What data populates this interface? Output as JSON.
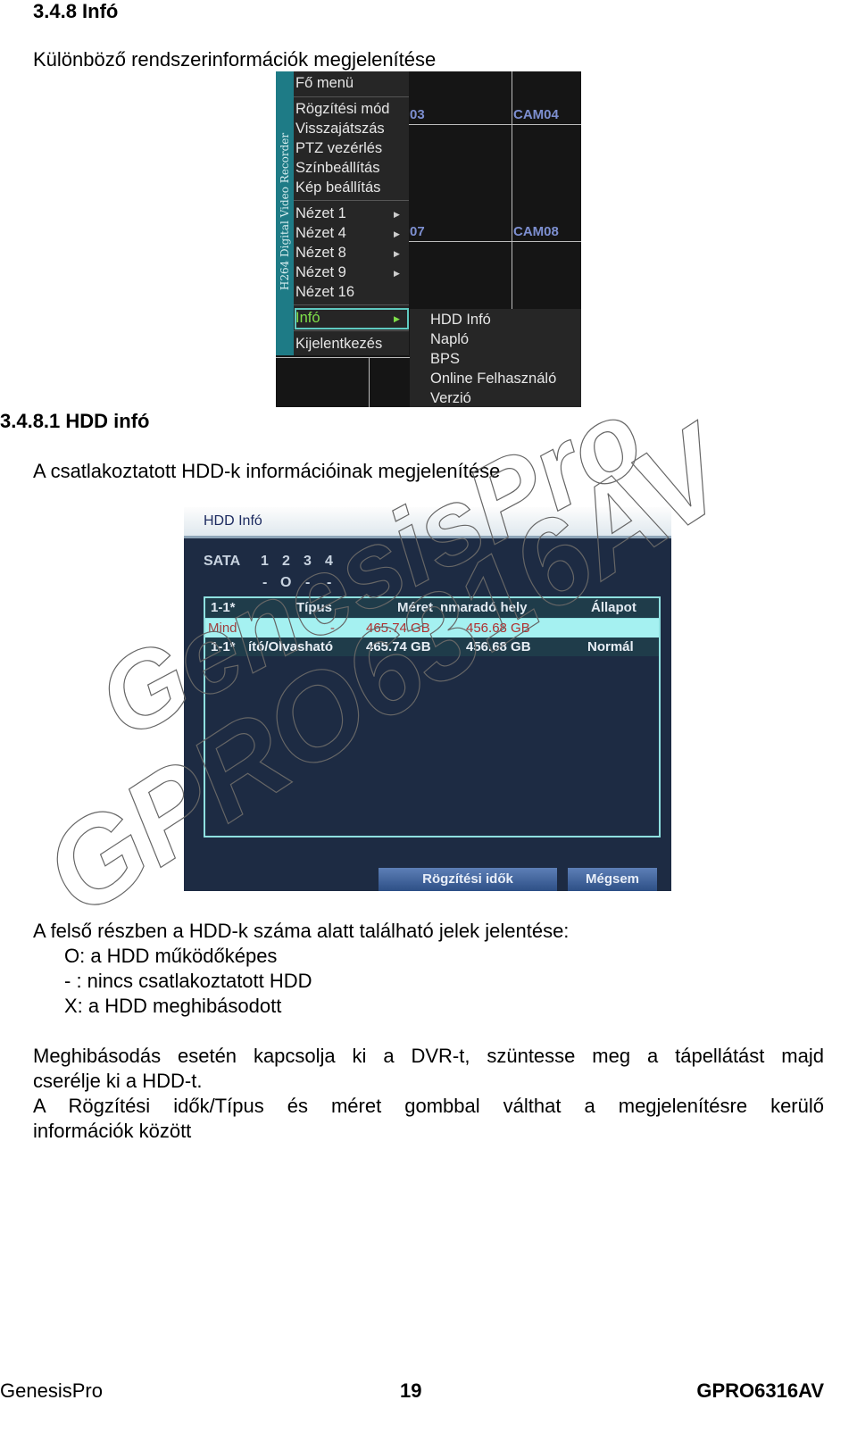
{
  "section": {
    "heading": "3.4.8 Infó",
    "intro": "Különböző rendszerinformációk megjelenítése"
  },
  "dvr_menu": {
    "side_label": "H264 Digital Video Recorder",
    "items": [
      "Fő menü",
      "Rögzítési mód",
      "Visszajátszás",
      "PTZ vezérlés",
      "Színbeállítás",
      "Kép beállítás",
      "Nézet 1",
      "Nézet 4",
      "Nézet 8",
      "Nézet 9",
      "Nézet 16",
      "Infó",
      "Kijelentkezés"
    ],
    "selected": "Infó",
    "submenu": [
      "HDD Infó",
      "Napló",
      "BPS",
      "Online Felhasználó",
      "Verzió"
    ],
    "cameras": [
      "03",
      "CAM04",
      "07",
      "CAM08"
    ]
  },
  "subsection": {
    "heading": "3.4.8.1 HDD infó",
    "intro": "A csatlakoztatott HDD-k információinak megjelenítése"
  },
  "hdd_dialog": {
    "title": "HDD Infó",
    "sata_label": "SATA",
    "sata_numbers": [
      "1",
      "2",
      "3",
      "4"
    ],
    "sata_status": [
      "-",
      "O",
      "-",
      "-"
    ],
    "columns": [
      "1-1*",
      "Típus",
      "Méret",
      "nmaradó hely",
      "Állapot"
    ],
    "rows": [
      [
        "Mind",
        "-",
        "465.74 GB",
        "456.68 GB",
        ""
      ],
      [
        "1-1*",
        "ító/Olvasható",
        "465.74 GB",
        "456.68 GB",
        "Normál"
      ]
    ],
    "buttons": [
      "Rögzítési idők",
      "Mégsem"
    ]
  },
  "legend": {
    "intro": "A felső részben a HDD-k száma alatt található jelek jelentése:",
    "items": [
      "O: a HDD működőképes",
      "- : nincs csatlakoztatott HDD",
      "X: a HDD meghibásodott"
    ]
  },
  "paragraphs": {
    "p1_line1": "Meghibásodás esetén kapcsolja ki a DVR-t, szüntesse meg a tápellátást majd",
    "p1_line2": "cserélje ki a HDD-t.",
    "p2_line1": "A Rögzítési idők/Típus és méret gombbal válthat a megjelenítésre kerülő",
    "p2_line2": "információk között"
  },
  "watermark": [
    "GenesisPro",
    "GPRO6316AV"
  ],
  "footer": {
    "left": "GenesisPro",
    "page": "19",
    "right": "GPRO6316AV"
  }
}
